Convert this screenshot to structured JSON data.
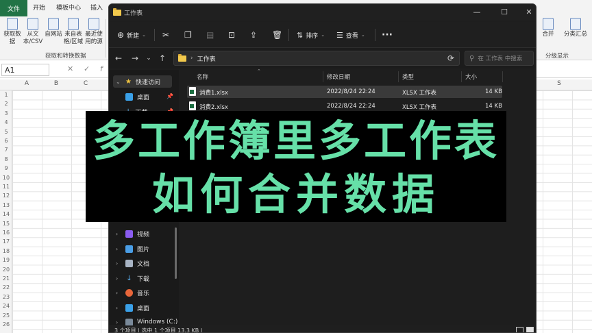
{
  "excel": {
    "tabs": [
      "文件",
      "开始",
      "模板中心",
      "插入"
    ],
    "ribbon_buttons": [
      {
        "label": "获取数据",
        "icon": "database-icon"
      },
      {
        "label": "从文本/CSV",
        "icon": "text-file-icon"
      },
      {
        "label": "自网站",
        "icon": "web-icon"
      },
      {
        "label": "来自表格/区域",
        "icon": "table-icon"
      },
      {
        "label": "最近使用的源",
        "icon": "recent-sources-icon"
      }
    ],
    "group_label": "获取和转换数据",
    "right_items": [
      "合并",
      "分类汇总"
    ],
    "right_group": "分级显示",
    "name_box": "A1",
    "columns": [
      "A",
      "B",
      "C",
      "S"
    ],
    "rows": [
      "1",
      "2",
      "3",
      "4",
      "5",
      "6",
      "7",
      "8",
      "9",
      "10",
      "11",
      "12",
      "13",
      "14",
      "15",
      "16",
      "17",
      "18",
      "19",
      "20",
      "21",
      "22",
      "23",
      "24",
      "25",
      "26"
    ]
  },
  "explorer": {
    "title": "工作表",
    "toolbar": {
      "new": "新建",
      "sort": "排序",
      "view": "查看"
    },
    "address": "工作表",
    "search_placeholder": "在 工作表 中搜索",
    "sidebar": [
      {
        "label": "快速访问",
        "icon": "star-icon",
        "selected": true,
        "pinned": false
      },
      {
        "label": "桌面",
        "icon": "desktop-icon",
        "pinned": true
      },
      {
        "label": "下载",
        "icon": "download-icon",
        "pinned": true
      },
      {
        "label": "视频",
        "icon": "video-icon"
      },
      {
        "label": "图片",
        "icon": "pictures-icon"
      },
      {
        "label": "文档",
        "icon": "documents-icon"
      },
      {
        "label": "下载",
        "icon": "download-icon"
      },
      {
        "label": "音乐",
        "icon": "music-icon"
      },
      {
        "label": "桌面",
        "icon": "desktop-icon"
      },
      {
        "label": "Windows (C:)",
        "icon": "drive-icon"
      }
    ],
    "columns": [
      "名称",
      "修改日期",
      "类型",
      "大小"
    ],
    "files": [
      {
        "name": "消费1.xlsx",
        "date": "2022/8/24 22:24",
        "type": "XLSX 工作表",
        "size": "14 KB",
        "selected": true
      },
      {
        "name": "消费2.xlsx",
        "date": "2022/8/24 22:24",
        "type": "XLSX 工作表",
        "size": "14 KB",
        "selected": false
      }
    ],
    "status": "3 个项目  |  选中 1 个项目  13.3 KB  |"
  },
  "overlay": {
    "line1": "多工作簿里多工作表",
    "line2": "如何合并数据"
  },
  "colors": {
    "excel_green": "#217346",
    "overlay_text": "#66e0a8",
    "explorer_bg": "#1e1e1e"
  }
}
